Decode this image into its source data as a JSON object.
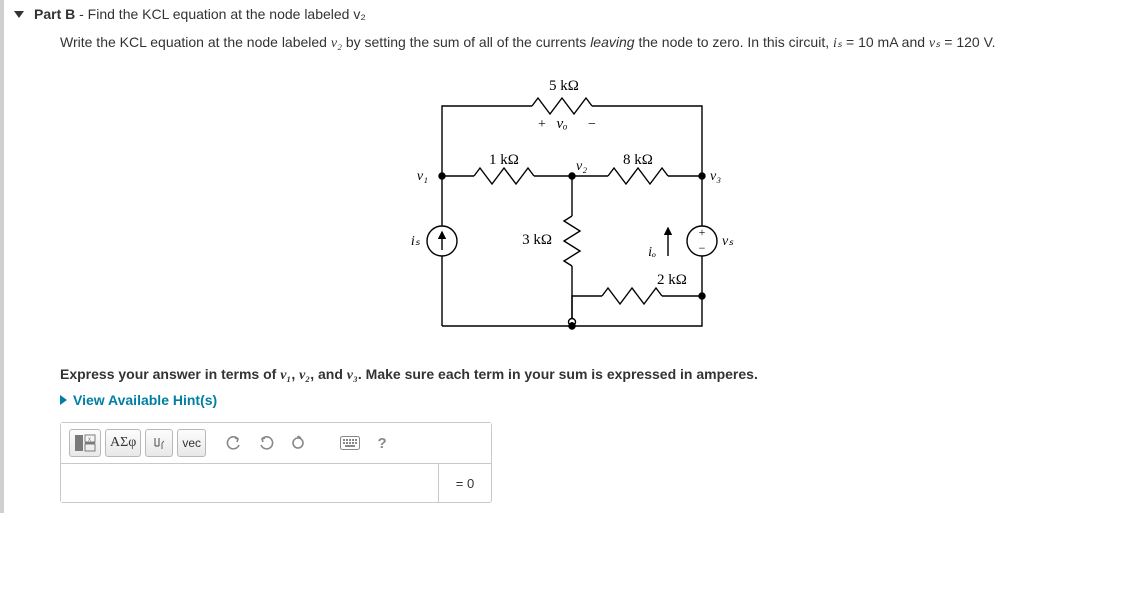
{
  "part": {
    "label_bold": "Part B",
    "label_rest": " - Find the KCL equation at the node labeled v₂",
    "prompt_pre": "Write the KCL equation at the node labeled ",
    "prompt_node": "v₂",
    "prompt_mid": " by setting the sum of all of the currents ",
    "prompt_em": "leaving",
    "prompt_post": " the node to zero. In this circuit, ",
    "is_label": "iₛ",
    "eq1": " = 10 mA",
    "and": " and ",
    "vs_label": "vₛ",
    "eq2": " = 120 V.",
    "instr_pre": "Express your answer in terms of ",
    "instr_v1": "v₁",
    "instr_sep1": ", ",
    "instr_v2": "v₂",
    "instr_sep2": ", and ",
    "instr_v3": "v₃",
    "instr_post": ". Make sure each term in your sum is expressed in amperes.",
    "hint": "View Available Hint(s)"
  },
  "circuit": {
    "r_top": "5 kΩ",
    "vo_plus": "+",
    "vo_label": "vₒ",
    "vo_minus": "−",
    "r_12": "1 kΩ",
    "r_23": "8 kΩ",
    "n_v1": "v₁",
    "n_v2": "v₂",
    "n_v3": "v₃",
    "r_mid": "3 kΩ",
    "is": "iₛ",
    "io": "iₒ",
    "vs": "vₛ",
    "vs_plus": "+",
    "vs_minus": "−",
    "r_bot": "2 kΩ"
  },
  "toolbar": {
    "greek": "ΑΣφ",
    "vec": "vec",
    "help": "?"
  },
  "answer": {
    "value": "",
    "rhs": "= 0"
  }
}
